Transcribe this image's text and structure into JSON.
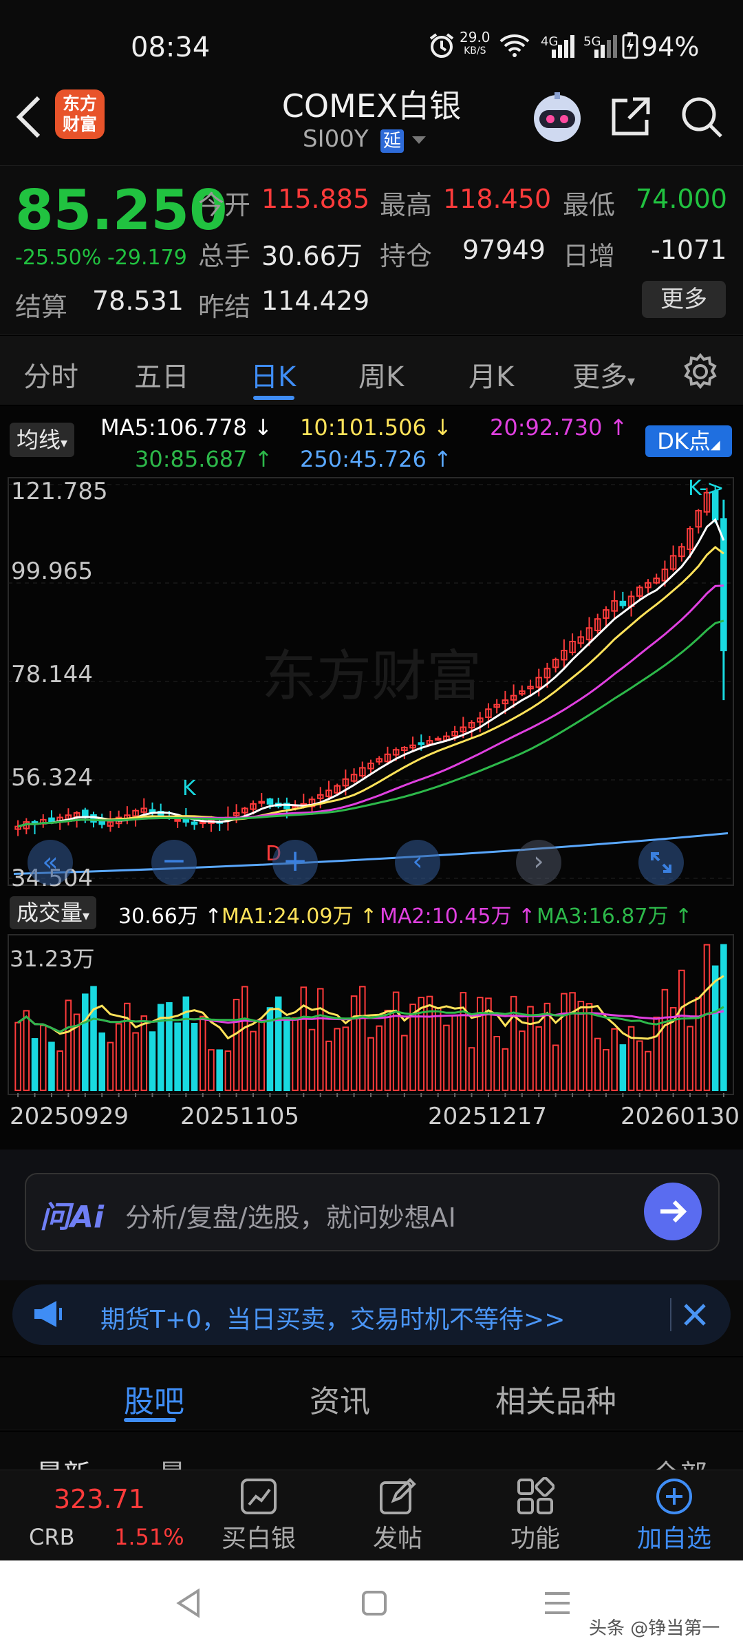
{
  "status_bar": {
    "time": "08:34",
    "net_speed": "29.0",
    "net_unit": "KB/S",
    "battery": "94%",
    "sig1": "4G",
    "sig2": "5G"
  },
  "header": {
    "logo_line1": "东方",
    "logo_line2": "财富",
    "title": "COMEX白银",
    "code": "SI00Y",
    "delay_badge": "延"
  },
  "quote": {
    "price": "85.250",
    "change_pct": "-25.50%",
    "change": "-29.179",
    "open_label": "今开",
    "open": "115.885",
    "high_label": "最高",
    "high": "118.450",
    "low_label": "最低",
    "low": "74.000",
    "volume_label": "总手",
    "volume": "30.66万",
    "oi_label": "持仓",
    "oi": "97949",
    "daily_inc_label": "日增",
    "daily_inc": "-1071",
    "settle_label": "结算",
    "settle": "78.531",
    "prev_settle_label": "昨结",
    "prev_settle": "114.429",
    "more_label": "更多"
  },
  "tabs": [
    {
      "label": "分时"
    },
    {
      "label": "五日"
    },
    {
      "label": "日K"
    },
    {
      "label": "周K"
    },
    {
      "label": "月K"
    },
    {
      "label": "更多"
    }
  ],
  "ma_legend": {
    "selector": "均线",
    "dk_label": "DK点",
    "ma5": "MA5:106.778",
    "ma10": "10:101.506",
    "ma20": "20:92.730",
    "ma30": "30:85.687",
    "ma250": "250:45.726",
    "colors": {
      "ma5": "#ffffff",
      "ma10": "#ffe35a",
      "ma20": "#e040e0",
      "ma30": "#2db84a",
      "ma250": "#5aa8ff"
    }
  },
  "volume_legend": {
    "selector": "成交量",
    "current": "30.66万",
    "ma1": "MA1:24.09万",
    "ma2": "MA2:10.45万",
    "ma3": "MA3:16.87万",
    "max_label": "31.23万"
  },
  "chart_data": {
    "type": "candlestick",
    "y_ticks": [
      "121.785",
      "99.965",
      "78.144",
      "56.324",
      "34.504"
    ],
    "ylim": [
      34.504,
      121.785
    ],
    "x_ticks": [
      "20250929",
      "20251105",
      "20251217",
      "20260130"
    ],
    "markers": {
      "k1": "K",
      "d1": "D",
      "k2": "K->"
    },
    "close": [
      46,
      47,
      46.5,
      47.5,
      47,
      48,
      48.5,
      49,
      48,
      47,
      46.5,
      47,
      48,
      48.5,
      49.5,
      50,
      49,
      48.5,
      48,
      47.5,
      47,
      46.5,
      47,
      47.5,
      47,
      48,
      49,
      50,
      51,
      51.5,
      51,
      50.5,
      50,
      50.5,
      51,
      52,
      53,
      54,
      55,
      56.5,
      57.5,
      59,
      60,
      61,
      62,
      63,
      63.5,
      64,
      64.5,
      65,
      65.5,
      66,
      67,
      68,
      69,
      70,
      72,
      73,
      74,
      75,
      76,
      77,
      79,
      81,
      83,
      85,
      87,
      88,
      90,
      92,
      94,
      96,
      95,
      97,
      99,
      100,
      101,
      103,
      106,
      108,
      112,
      116,
      120,
      114,
      85
    ]
  },
  "ai_bar": {
    "logo": "问Ai",
    "placeholder": "分析/复盘/选股，就问妙想AI"
  },
  "promo": {
    "text": "期货T+0，当日买卖，交易时机不等待>>"
  },
  "subtabs": [
    {
      "label": "股吧"
    },
    {
      "label": "资讯"
    },
    {
      "label": "相关品种"
    }
  ],
  "partial_row": {
    "left": "最新",
    "mid": "最",
    "right": "全部"
  },
  "bottom_nav": {
    "crb_value": "323.71",
    "crb_label": "CRB",
    "crb_change": "1.51%",
    "items": [
      {
        "label": "买白银"
      },
      {
        "label": "发帖"
      },
      {
        "label": "功能"
      },
      {
        "label": "加自选"
      }
    ]
  },
  "watermark": "头条 @铮当第一",
  "chart_watermark": "东方财富"
}
